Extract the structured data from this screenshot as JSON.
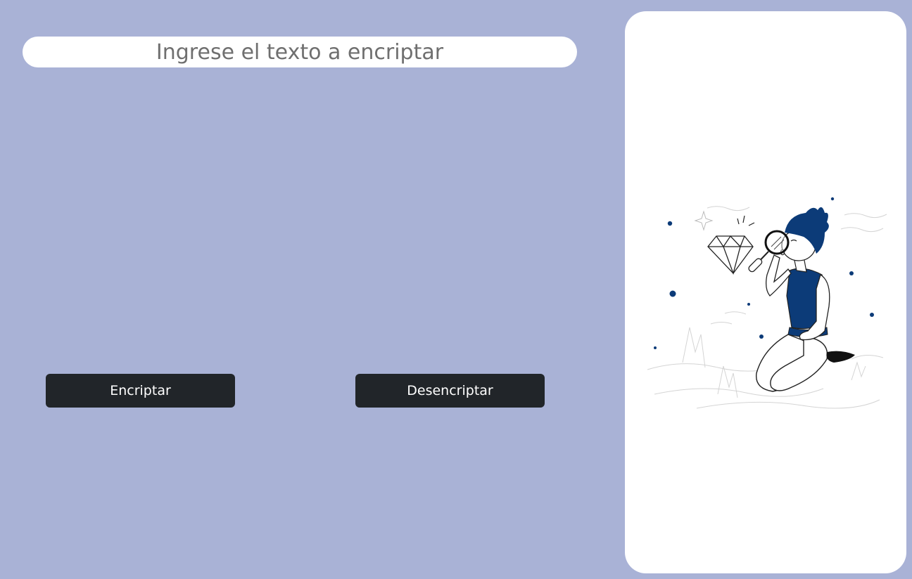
{
  "input": {
    "placeholder": "Ingrese el texto a encriptar",
    "value": ""
  },
  "buttons": {
    "encrypt_label": "Encriptar",
    "decrypt_label": "Desencriptar"
  },
  "output_panel": {
    "illustration_icon": "person-magnifying-glass-diamond-illustration"
  },
  "colors": {
    "background": "#a9b2d6",
    "panel": "#ffffff",
    "button": "#212529",
    "button_text": "#ffffff",
    "accent": "#0c3b78"
  }
}
